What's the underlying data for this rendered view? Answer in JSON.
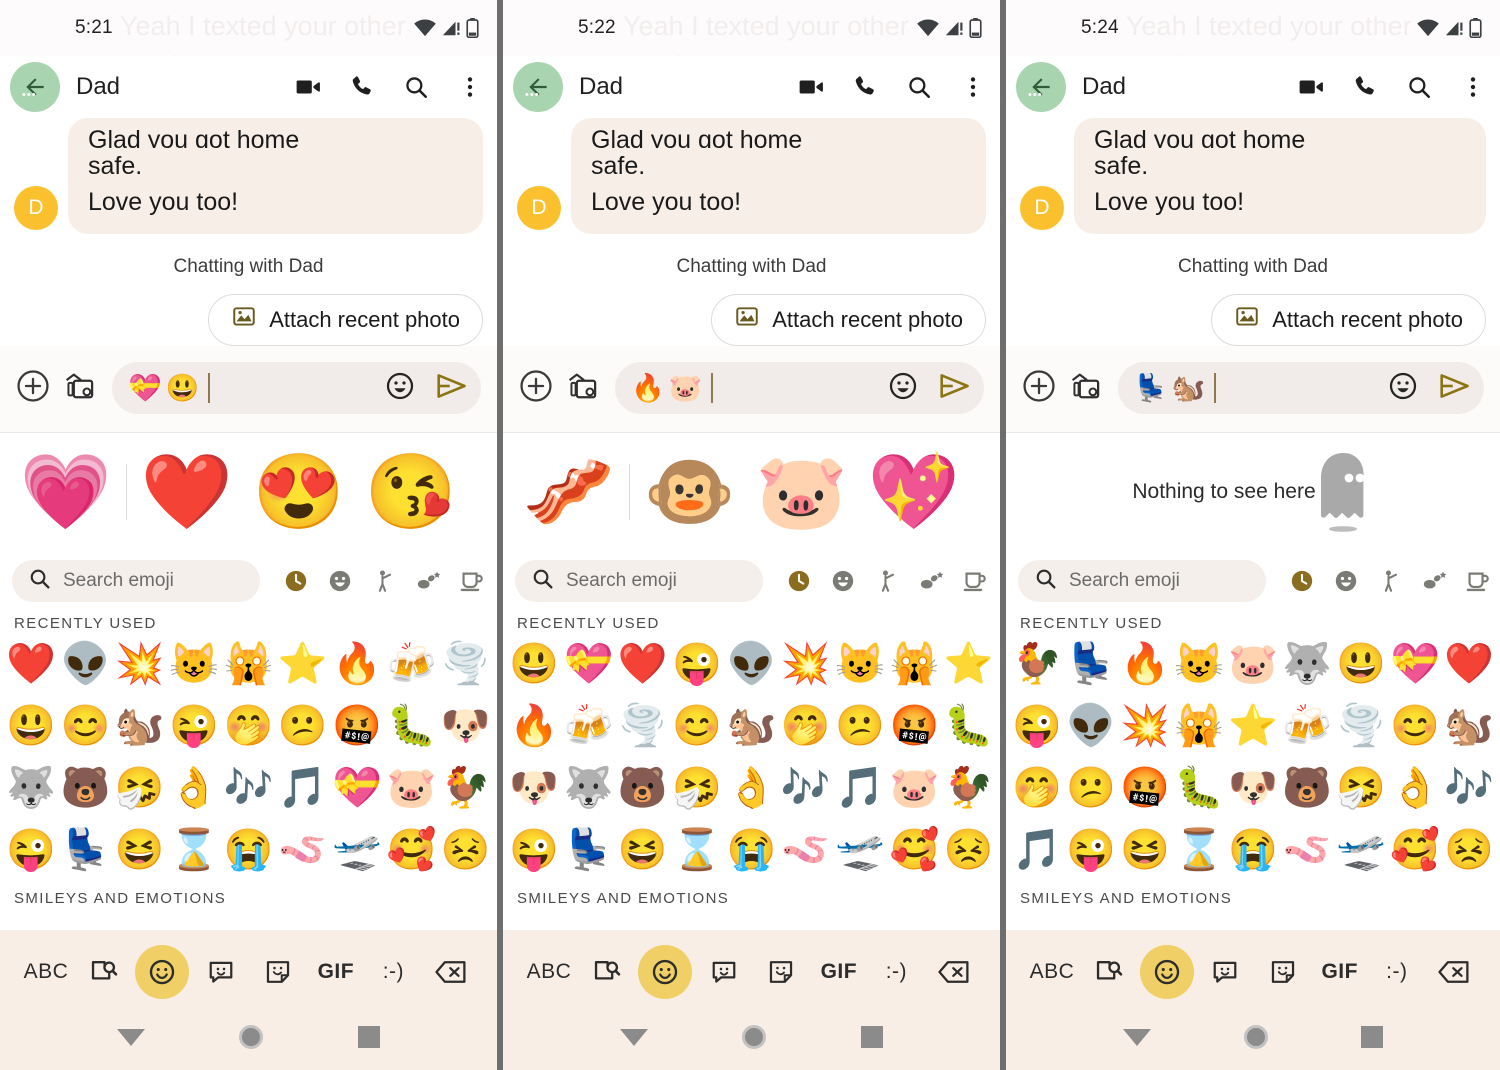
{
  "app": {
    "name": "Google Messages",
    "accent_gold": "#8a6d1e",
    "bubble_bg": "#f7efe7",
    "keyboard_bg": "#f8eee6",
    "divider_color": "#6e6e6e"
  },
  "shared": {
    "appbar_title": "Dad",
    "avatar_letter": "D",
    "faded_background_message": "Yeah I texted your other number. Love you!",
    "bubble_clipped_line": "Glad you got home",
    "bubble_line_2": "safe.",
    "bubble_line_3": "Love you too!",
    "chatting_with": "Chatting with Dad",
    "attach_label": "Attach recent photo",
    "search_placeholder": "Search emoji",
    "recently_used_label": "RECENTLY USED",
    "smileys_label": "SMILEYS AND EMOTIONS",
    "keyboard": {
      "abc": "ABC",
      "gif": "GIF",
      "emoticon": ":-)"
    },
    "category_tabs": [
      {
        "name": "recent",
        "glyph": "🕐",
        "active": true
      },
      {
        "name": "smileys",
        "glyph": "☺",
        "active": false
      },
      {
        "name": "people",
        "glyph": "🚶",
        "active": false
      },
      {
        "name": "animals-nature",
        "glyph": "🌿",
        "active": false
      },
      {
        "name": "food-drink",
        "glyph": "☕",
        "active": false
      }
    ]
  },
  "panels": [
    {
      "id": "panel-1",
      "status_time": "5:21",
      "composer_emoji": [
        "💝",
        "😃"
      ],
      "kitchen_empty": false,
      "kitchen_primary": "💗",
      "kitchen_suggestions": [
        "❤️",
        "😍",
        "😘"
      ],
      "recently_used": [
        "❤️",
        "👽",
        "💥",
        "😺",
        "🙀",
        "⭐",
        "🔥",
        "🍻",
        "🌪️",
        "😃",
        "😊",
        "🐿️",
        "😜",
        "🤭",
        "😕",
        "🤬",
        "🐛",
        "🐶",
        "🐺",
        "🐻",
        "🤧",
        "👌",
        "🎶",
        "🎵",
        "💝",
        "🐷",
        "🐓",
        "😜",
        "💺",
        "😆",
        "⌛",
        "😭",
        "🪱",
        "🛫",
        "🥰",
        "😣"
      ]
    },
    {
      "id": "panel-2",
      "status_time": "5:22",
      "composer_emoji": [
        "🔥",
        "🐷"
      ],
      "kitchen_empty": false,
      "kitchen_primary": "🥓",
      "kitchen_suggestions": [
        "🐵",
        "🐷",
        "💖"
      ],
      "recently_used": [
        "😃",
        "💝",
        "❤️",
        "😜",
        "👽",
        "💥",
        "😺",
        "🙀",
        "⭐",
        "🔥",
        "🍻",
        "🌪️",
        "😊",
        "🐿️",
        "🤭",
        "😕",
        "🤬",
        "🐛",
        "🐶",
        "🐺",
        "🐻",
        "🤧",
        "👌",
        "🎶",
        "🎵",
        "🐷",
        "🐓",
        "😜",
        "💺",
        "😆",
        "⌛",
        "😭",
        "🪱",
        "🛫",
        "🥰",
        "😣"
      ]
    },
    {
      "id": "panel-3",
      "status_time": "5:24",
      "composer_emoji": [
        "💺",
        "🐿️"
      ],
      "kitchen_empty": true,
      "kitchen_empty_text": "Nothing to see here",
      "kitchen_primary": "",
      "kitchen_suggestions": [],
      "recently_used": [
        "🐓",
        "💺",
        "🔥",
        "😺",
        "🐷",
        "🐺",
        "😃",
        "💝",
        "❤️",
        "😜",
        "👽",
        "💥",
        "🙀",
        "⭐",
        "🍻",
        "🌪️",
        "😊",
        "🐿️",
        "🤭",
        "😕",
        "🤬",
        "🐛",
        "🐶",
        "🐻",
        "🤧",
        "👌",
        "🎶",
        "🎵",
        "😜",
        "😆",
        "⌛",
        "😭",
        "🪱",
        "🛫",
        "🥰",
        "😣"
      ]
    }
  ]
}
